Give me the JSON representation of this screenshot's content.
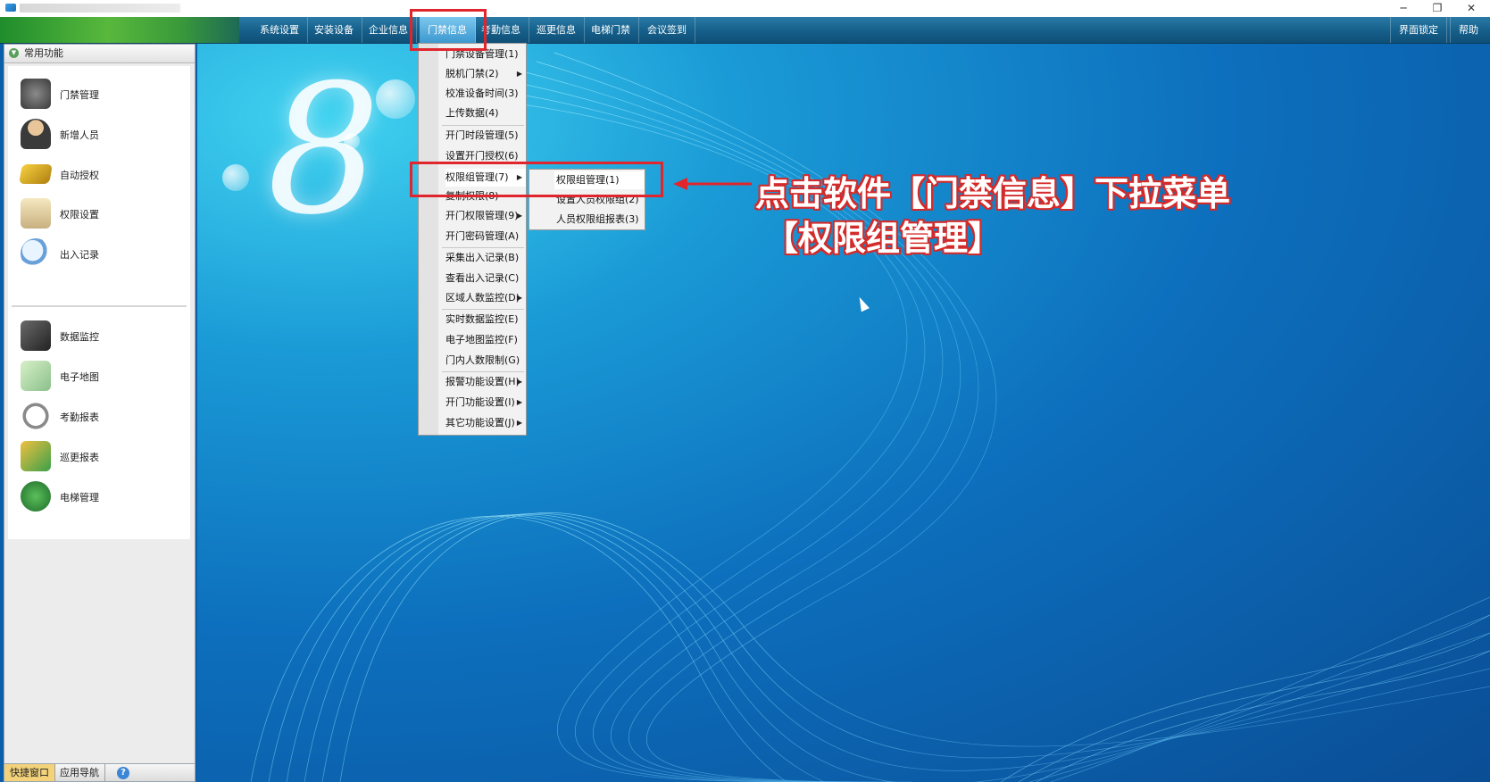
{
  "window": {
    "title_text": "",
    "controls": [
      "─",
      "❐",
      "✕"
    ]
  },
  "menu": {
    "items": [
      "系统设置",
      "安装设备",
      "企业信息",
      "门禁信息",
      "考勤信息",
      "巡更信息",
      "电梯门禁",
      "会议签到"
    ],
    "right": [
      "界面锁定",
      "帮助"
    ]
  },
  "sidebar": {
    "header": "常用功能",
    "items": [
      {
        "label": "门禁管理",
        "icon": "door-access-icon",
        "color": "#6a6a6a"
      },
      {
        "label": "新增人员",
        "icon": "person-icon",
        "color": "#b08a5a"
      },
      {
        "label": "自动授权",
        "icon": "card-icon",
        "color": "#e0b020"
      },
      {
        "label": "权限设置",
        "icon": "permission-doc-icon",
        "color": "#d6c08a"
      },
      {
        "label": "出入记录",
        "icon": "magnifier-icon",
        "color": "#7fb0e0"
      },
      {
        "label": "数据监控",
        "icon": "camera-icon",
        "color": "#4a4a4a"
      },
      {
        "label": "电子地图",
        "icon": "map-icon",
        "color": "#8ac08a"
      },
      {
        "label": "考勤报表",
        "icon": "clock-icon",
        "color": "#a0a0a0"
      },
      {
        "label": "巡更报表",
        "icon": "patrol-icon",
        "color": "#e0a030"
      },
      {
        "label": "电梯管理",
        "icon": "elevator-icon",
        "color": "#3a9a3a"
      }
    ],
    "bottom_tabs": [
      "快捷窗口",
      "应用导航"
    ]
  },
  "dropdown": {
    "items": [
      {
        "label": "门禁设备管理(1)",
        "arrow": false
      },
      {
        "label": "脱机门禁(2)",
        "arrow": true
      },
      {
        "label": "校准设备时间(3)",
        "arrow": false
      },
      {
        "label": "上传数据(4)",
        "arrow": false
      },
      {
        "label": "开门时段管理(5)",
        "arrow": false
      },
      {
        "label": "设置开门授权(6)",
        "arrow": false
      },
      {
        "label": "权限组管理(7)",
        "arrow": true
      },
      {
        "label": "复制权限(8)",
        "arrow": false
      },
      {
        "label": "开门权限管理(9)",
        "arrow": true
      },
      {
        "label": "开门密码管理(A)",
        "arrow": false
      },
      {
        "label": "采集出入记录(B)",
        "arrow": false
      },
      {
        "label": "查看出入记录(C)",
        "arrow": false
      },
      {
        "label": "区域人数监控(D)",
        "arrow": true
      },
      {
        "label": "实时数据监控(E)",
        "arrow": false
      },
      {
        "label": "电子地图监控(F)",
        "arrow": false
      },
      {
        "label": "门内人数限制(G)",
        "arrow": false
      },
      {
        "label": "报警功能设置(H)",
        "arrow": true
      },
      {
        "label": "开门功能设置(I)",
        "arrow": true
      },
      {
        "label": "其它功能设置(J)",
        "arrow": true
      }
    ]
  },
  "submenu": {
    "items": [
      "权限组管理(1)",
      "设置人员权限组(2)",
      "人员权限组报表(3)"
    ]
  },
  "annotation": {
    "line1": "点击软件【门禁信息】下拉菜单",
    "line2": "【权限组管理】",
    "color": "#e0262c"
  },
  "desktop": {
    "logo_glyph": "8"
  }
}
